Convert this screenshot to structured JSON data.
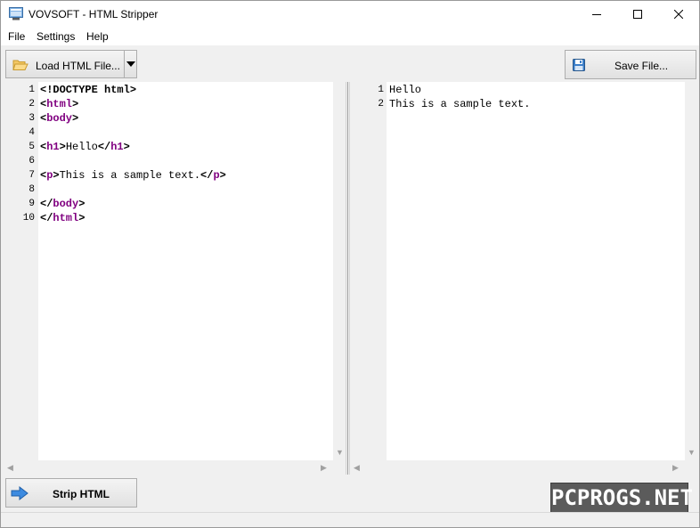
{
  "window": {
    "title": "VOVSOFT - HTML Stripper"
  },
  "menu": {
    "file": "File",
    "settings": "Settings",
    "help": "Help"
  },
  "toolbar": {
    "load_label": "Load HTML File...",
    "save_label": "Save File..."
  },
  "left_editor": {
    "line_numbers": [
      "1",
      "2",
      "3",
      "4",
      "5",
      "6",
      "7",
      "8",
      "9",
      "10"
    ],
    "lines": [
      {
        "parts": [
          {
            "text": "<!DOCTYPE html>",
            "style": "bold"
          }
        ]
      },
      {
        "parts": [
          {
            "text": "<",
            "style": "bold"
          },
          {
            "text": "html",
            "style": "tag"
          },
          {
            "text": ">",
            "style": "bold"
          }
        ]
      },
      {
        "parts": [
          {
            "text": "<",
            "style": "bold"
          },
          {
            "text": "body",
            "style": "tag"
          },
          {
            "text": ">",
            "style": "bold"
          }
        ]
      },
      {
        "parts": []
      },
      {
        "parts": [
          {
            "text": "<",
            "style": "bold"
          },
          {
            "text": "h1",
            "style": "tag"
          },
          {
            "text": ">",
            "style": "bold"
          },
          {
            "text": "Hello",
            "style": "plain"
          },
          {
            "text": "</",
            "style": "bold"
          },
          {
            "text": "h1",
            "style": "tag"
          },
          {
            "text": ">",
            "style": "bold"
          }
        ]
      },
      {
        "parts": []
      },
      {
        "parts": [
          {
            "text": "<",
            "style": "bold"
          },
          {
            "text": "p",
            "style": "tag"
          },
          {
            "text": ">",
            "style": "bold"
          },
          {
            "text": "This is a sample text.",
            "style": "plain"
          },
          {
            "text": "</",
            "style": "bold"
          },
          {
            "text": "p",
            "style": "tag"
          },
          {
            "text": ">",
            "style": "bold"
          }
        ]
      },
      {
        "parts": []
      },
      {
        "parts": [
          {
            "text": "</",
            "style": "bold"
          },
          {
            "text": "body",
            "style": "tag"
          },
          {
            "text": ">",
            "style": "bold"
          }
        ]
      },
      {
        "parts": [
          {
            "text": "</",
            "style": "bold"
          },
          {
            "text": "html",
            "style": "tag"
          },
          {
            "text": ">",
            "style": "bold"
          }
        ]
      }
    ]
  },
  "right_editor": {
    "line_numbers": [
      "1",
      "2"
    ],
    "lines": [
      "Hello",
      "This is a sample text."
    ]
  },
  "actions": {
    "strip_label": "Strip HTML"
  },
  "watermark": {
    "text": "PCPROGS.NET"
  },
  "icons": {
    "app": "app-window-icon",
    "load": "folder-open-icon",
    "save": "floppy-disk-icon",
    "strip": "arrow-right-icon"
  },
  "colors": {
    "tag": "#800080",
    "gutter": "#f0f0f0",
    "chrome": "#f0f0f0"
  }
}
